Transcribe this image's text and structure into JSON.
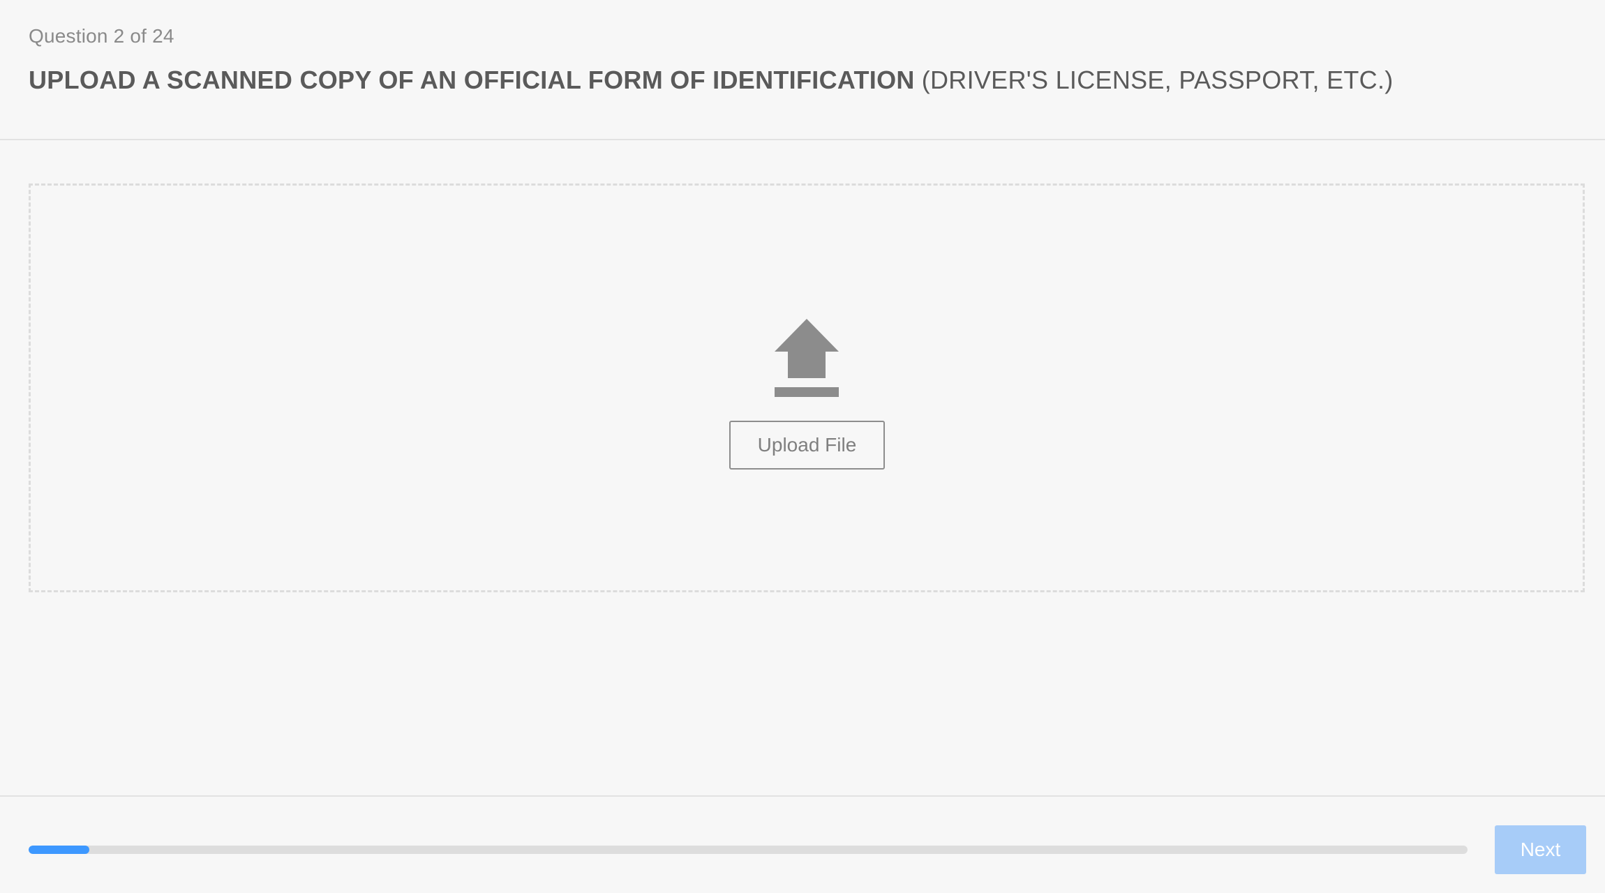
{
  "question": {
    "counter": "Question 2 of 24",
    "title_bold": "UPLOAD A SCANNED COPY OF AN OFFICIAL FORM OF IDENTIFICATION",
    "title_normal": "(DRIVER'S LICENSE, PASSPORT, ETC.)"
  },
  "upload": {
    "icon": "upload-arrow-icon",
    "button_label": "Upload File"
  },
  "footer": {
    "progress_fraction": 0.042,
    "next_label": "Next"
  },
  "colors": {
    "background": "#f7f7f7",
    "accent": "#3d98ff",
    "next_button_disabled": "#a7ccf8",
    "title_text": "#5a5a5a",
    "muted_text": "#8a8a8a"
  }
}
